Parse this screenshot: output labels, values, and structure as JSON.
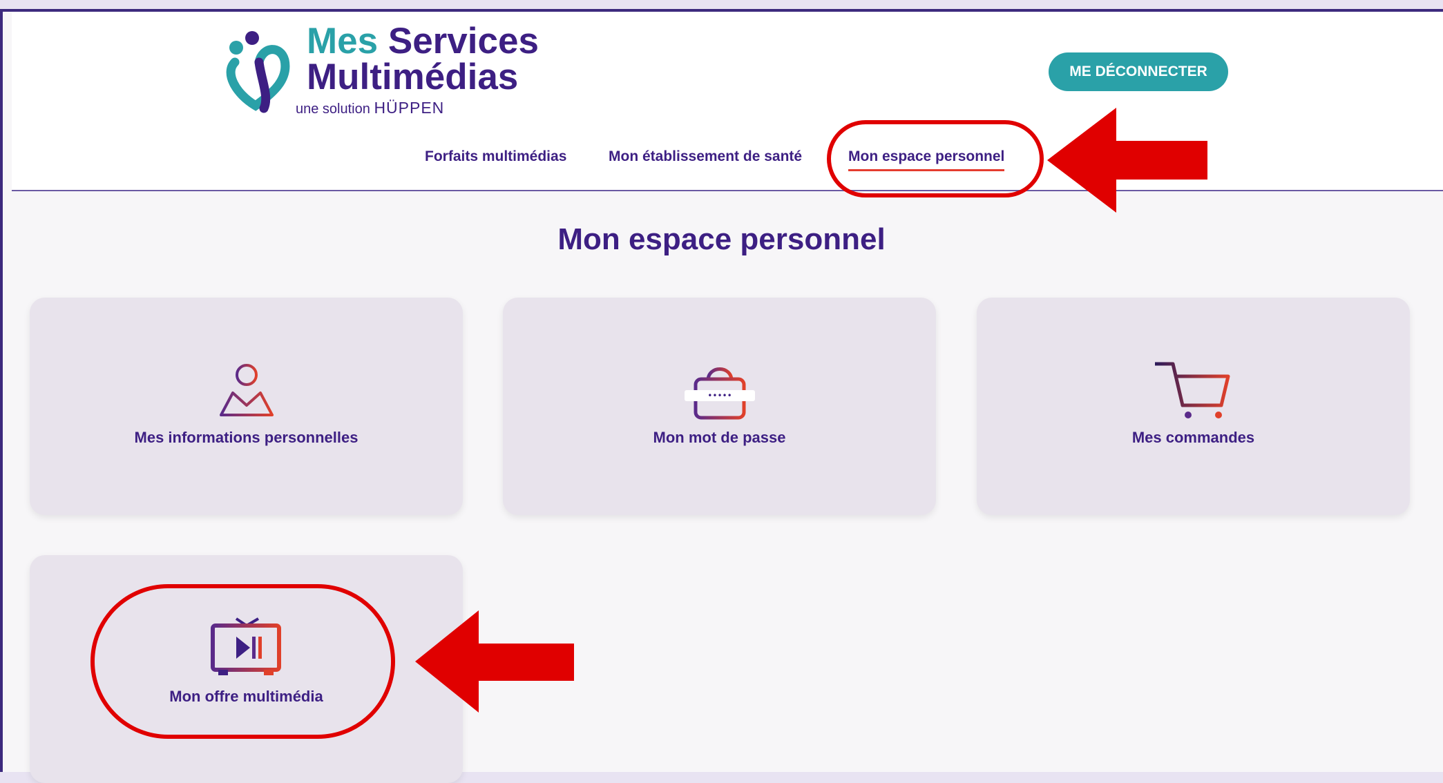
{
  "logo": {
    "mes": "Mes",
    "services": "Services",
    "multimedias": "Multimédias",
    "tagline": "une solution",
    "brand": "HÜPPEN"
  },
  "header": {
    "logout_label": "ME DÉCONNECTER"
  },
  "nav": {
    "items": [
      {
        "label": "Forfaits multimédias"
      },
      {
        "label": "Mon établissement de santé"
      },
      {
        "label": "Mon espace personnel",
        "active": true
      }
    ]
  },
  "main": {
    "title": "Mon espace personnel",
    "cards": [
      {
        "label": "Mes informations personnelles",
        "icon": "user-icon"
      },
      {
        "label": "Mon mot de passe",
        "icon": "lock-password-icon"
      },
      {
        "label": "Mes commandes",
        "icon": "cart-icon"
      },
      {
        "label": "Mon offre multimédia",
        "icon": "tv-play-icon"
      }
    ]
  },
  "colors": {
    "brand": "#3d1f83",
    "accent": "#2aa1a8",
    "annotation": "#e00000"
  }
}
